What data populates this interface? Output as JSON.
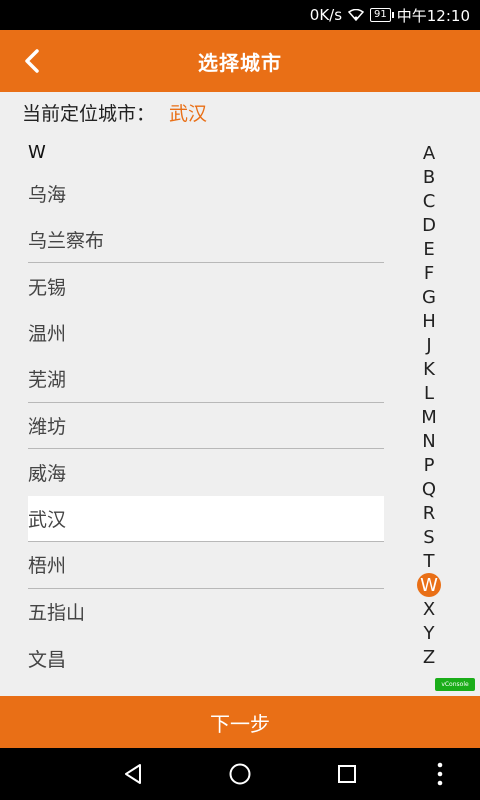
{
  "status_bar": {
    "speed": "0K/s",
    "battery": "91",
    "time": "中午12:10"
  },
  "header": {
    "title": "选择城市"
  },
  "current_location": {
    "label": "当前定位城市：",
    "city": "武汉"
  },
  "list": {
    "letter": "W",
    "cities": [
      "乌海",
      "乌兰察布",
      "无锡",
      "温州",
      "芜湖",
      "潍坊",
      "威海",
      "武汉",
      "梧州",
      "五指山",
      "文昌"
    ],
    "selected": "武汉"
  },
  "index": {
    "letters": [
      "A",
      "B",
      "C",
      "D",
      "E",
      "F",
      "G",
      "H",
      "J",
      "K",
      "L",
      "M",
      "N",
      "P",
      "Q",
      "R",
      "S",
      "T",
      "W",
      "X",
      "Y",
      "Z"
    ],
    "active": "W"
  },
  "vconsole_label": "vConsole",
  "footer": {
    "next_label": "下一步"
  },
  "colors": {
    "accent": "#e96f16",
    "background": "#efefef"
  },
  "icons": {
    "back": "chevron-left-icon",
    "wifi": "wifi-icon",
    "nav_back": "triangle-back-icon",
    "nav_home": "circle-home-icon",
    "nav_recent": "square-recents-icon",
    "nav_menu": "three-dots-icon"
  }
}
